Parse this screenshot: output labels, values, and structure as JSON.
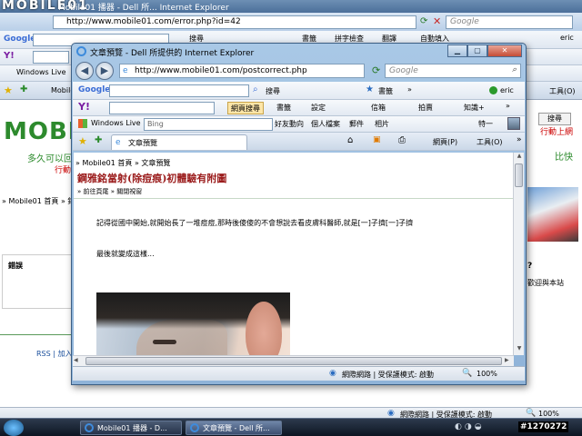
{
  "bg_window": {
    "title": "Mobile01 播器 - Dell 所... Internet Explorer",
    "address": "http://www.mobile01.com/error.php?id=42",
    "search_placeholder": "Google",
    "google_label": "Google",
    "toolbar_items": [
      "搜尋",
      "書籤",
      "拼字檢查",
      "翻譯",
      "自動填入"
    ],
    "user": "eric",
    "yahoo_label": "Y!",
    "winlive_label": "Windows Live",
    "tab_label": "Mobile",
    "tools_label": "工具(O)",
    "logo": "MOBIL",
    "left_text": "多久可以回",
    "action_link": "行動",
    "breadcrumb": "» Mobile01 首頁 » 錯",
    "error_heading": "錯誤",
    "footer_links": "RSS | 加入",
    "right_link": "行動上網",
    "right_text": "比快",
    "search_button": "搜尋",
    "welcome": "歡迎與本站",
    "question": "?",
    "zoom": "100%",
    "status": "網際網路 | 受保護模式: 啟動"
  },
  "fg_window": {
    "title": "文章預覽 - Dell 所提供的 Internet Explorer",
    "address": "http://www.mobile01.com/postcorrect.php",
    "search_placeholder": "Google",
    "google_label": "Google",
    "google_items": [
      "搜尋",
      "書籤",
      "»"
    ],
    "user": "eric",
    "yahoo_search_button": "網頁搜尋",
    "yahoo_items": [
      "書籤",
      "設定",
      "信箱",
      "拍賣",
      "知識+",
      "»"
    ],
    "winlive_label": "Windows Live",
    "bing_placeholder": "Bing",
    "winlive_items": [
      "好友動向",
      "個人檔案",
      "郵件",
      "相片"
    ],
    "winlive_user": "特一",
    "tab_label": "文章預覽",
    "page_menu": "網頁(P)",
    "tools_menu": "工具(O)",
    "breadcrumb": "» Mobile01 首頁 » 文章預覽",
    "article_title": "鋼雅銘當射(除痘痕)初體驗有附圖",
    "sub_links": "» 前往頁尾 » 關閉視窗",
    "paragraph1": "記得從國中開始,就開始長了一堆痘痘,那時後傻傻的不會想說去看皮膚科醫師,就是[一]子擠[一]子擠",
    "paragraph2": "最後就變成這樣...",
    "status": "網際網路 | 受保護模式: 啟動",
    "zoom": "100%"
  },
  "taskbar": {
    "buttons": [
      {
        "label": "Mobile01 播器 - D..."
      },
      {
        "label": "文章預覽 - Dell 所..."
      }
    ],
    "clock": "#1270272"
  },
  "watermark": "MOBILE01"
}
